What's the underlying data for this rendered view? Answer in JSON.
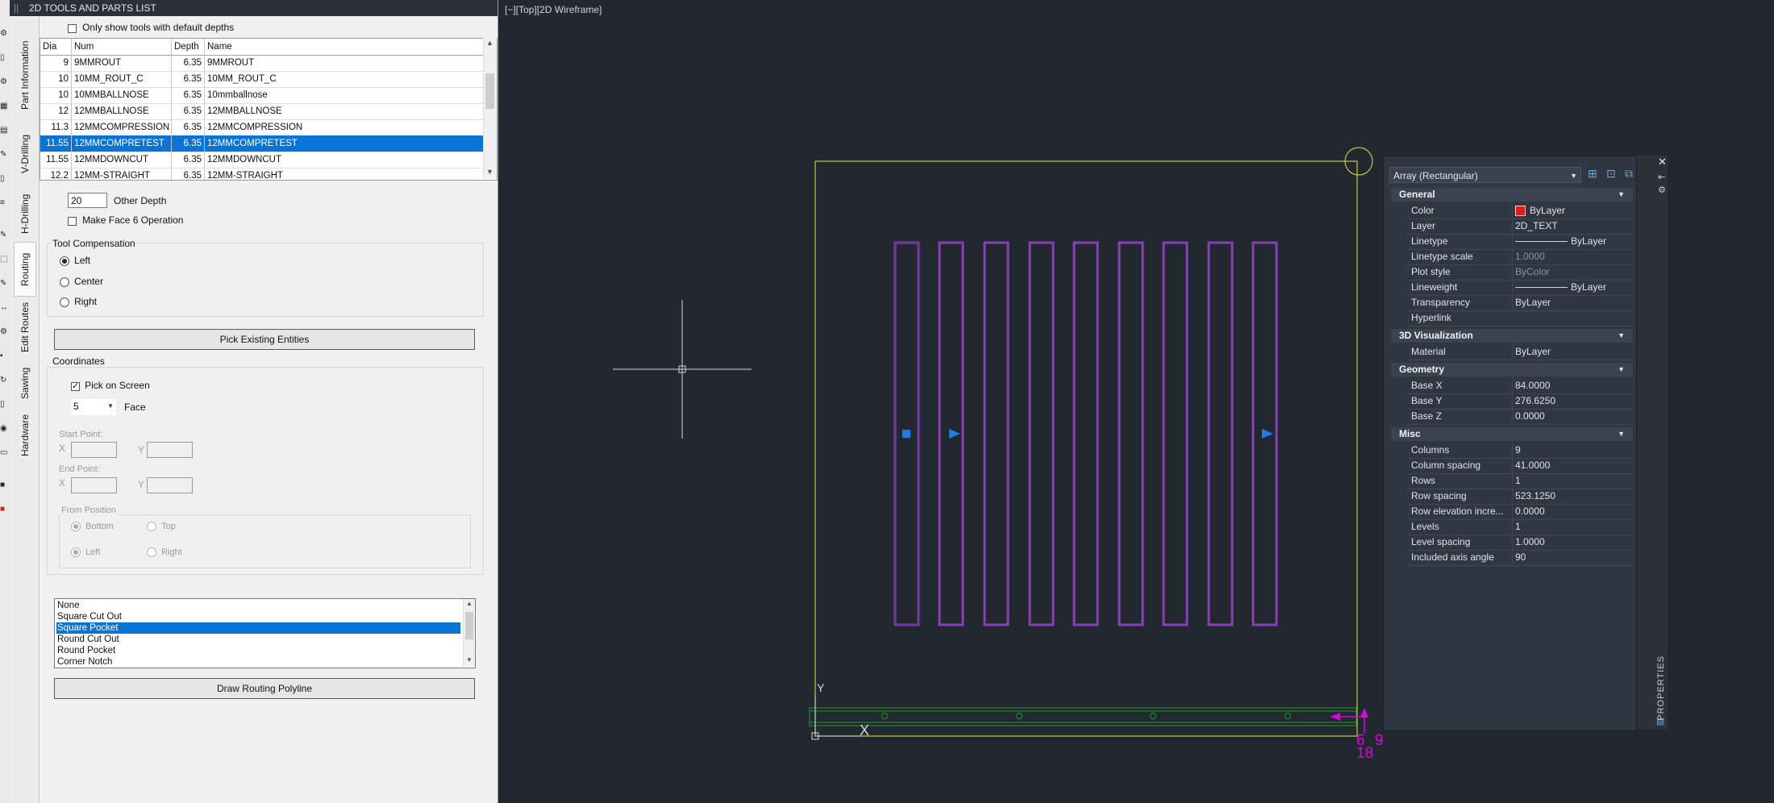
{
  "panel": {
    "title": "2D TOOLS AND PARTS LIST",
    "grip": "||",
    "only_default_depths_label": "Only show tools with default depths",
    "only_default_depths_checked": false,
    "tabs": [
      "Part Information",
      "V-Drilling",
      "H-Drilling",
      "Routing",
      "Edit Routes",
      "Sawing",
      "Hardware"
    ],
    "active_tab": "Routing",
    "table": {
      "headers": [
        "Dia",
        "Num",
        "Depth",
        "Name"
      ],
      "rows": [
        {
          "dia": "9",
          "num": "9MMROUT",
          "depth": "6.35",
          "name": "9MMROUT"
        },
        {
          "dia": "10",
          "num": "10MM_ROUT_C",
          "depth": "6.35",
          "name": "10MM_ROUT_C"
        },
        {
          "dia": "10",
          "num": "10MMBALLNOSE",
          "depth": "6.35",
          "name": "10mmballnose"
        },
        {
          "dia": "12",
          "num": "12MMBALLNOSE",
          "depth": "6.35",
          "name": "12MMBALLNOSE"
        },
        {
          "dia": "11.3",
          "num": "12MMCOMPRESSION",
          "depth": "6.35",
          "name": "12MMCOMPRESSION"
        },
        {
          "dia": "11.55",
          "num": "12MMCOMPRETEST",
          "depth": "6.35",
          "name": "12MMCOMPRETEST",
          "selected": true
        },
        {
          "dia": "11.55",
          "num": "12MMDOWNCUT",
          "depth": "6.35",
          "name": "12MMDOWNCUT"
        },
        {
          "dia": "12.2",
          "num": "12MM-STRAIGHT",
          "depth": "6.35",
          "name": "12MM-STRAIGHT"
        }
      ]
    },
    "other_depth_value": "20",
    "other_depth_label": "Other Depth",
    "face6_label": "Make Face 6 Operation",
    "face6_checked": false,
    "tool_comp": {
      "title": "Tool Compensation",
      "options": [
        "Left",
        "Center",
        "Right"
      ],
      "selected": "Left"
    },
    "pick_existing_label": "Pick Existing Entities",
    "coordinates": {
      "title": "Coordinates",
      "pick_on_screen_label": "Pick on Screen",
      "pick_on_screen_checked": true,
      "face_value": "5",
      "face_label": "Face",
      "start_point_label": "Start Point:",
      "end_point_label": "End Point:",
      "x_label": "X",
      "y_label": "Y",
      "from_position": {
        "title": "From Position",
        "options": [
          "Bottom",
          "Top",
          "Left",
          "Right"
        ],
        "selected": [
          "Bottom",
          "Left"
        ]
      }
    },
    "shape_list": {
      "items": [
        "None",
        "Square Cut Out",
        "Square Pocket",
        "Round Cut Out",
        "Round Pocket",
        "Corner Notch"
      ],
      "selected": "Square Pocket"
    },
    "draw_polyline_label": "Draw Routing Polyline"
  },
  "viewport": {
    "label": "[−][Top][2D Wireframe]",
    "ucs_y": "Y",
    "ucs_x": "X",
    "dim_text_1": "6",
    "dim_text_2": "9",
    "dim_text_3": "18",
    "colors": {
      "border": "#c8c83c",
      "rect": "#8a3fb8",
      "rail": "#1f9a2a",
      "grip": "#1e7ce6",
      "magenta": "#e000e0"
    }
  },
  "properties": {
    "selection": "Array (Rectangular)",
    "side_title": "PROPERTIES",
    "sections": [
      {
        "name": "General",
        "rows": [
          {
            "key": "Color",
            "value": "ByLayer",
            "swatch": "#e21b1b"
          },
          {
            "key": "Layer",
            "value": "2D_TEXT"
          },
          {
            "key": "Linetype",
            "value": "ByLayer",
            "line": true
          },
          {
            "key": "Linetype scale",
            "value": "1.0000",
            "dim": true
          },
          {
            "key": "Plot style",
            "value": "ByColor",
            "dim": true
          },
          {
            "key": "Lineweight",
            "value": "ByLayer",
            "line": true
          },
          {
            "key": "Transparency",
            "value": "ByLayer"
          },
          {
            "key": "Hyperlink",
            "value": ""
          }
        ]
      },
      {
        "name": "3D Visualization",
        "rows": [
          {
            "key": "Material",
            "value": "ByLayer"
          }
        ]
      },
      {
        "name": "Geometry",
        "rows": [
          {
            "key": "Base X",
            "value": "84.0000"
          },
          {
            "key": "Base Y",
            "value": "276.6250"
          },
          {
            "key": "Base Z",
            "value": "0.0000"
          }
        ]
      },
      {
        "name": "Misc",
        "rows": [
          {
            "key": "Columns",
            "value": "9"
          },
          {
            "key": "Column spacing",
            "value": "41.0000"
          },
          {
            "key": "Rows",
            "value": "1"
          },
          {
            "key": "Row spacing",
            "value": "523.1250"
          },
          {
            "key": "Row elevation incre...",
            "value": "0.0000"
          },
          {
            "key": "Levels",
            "value": "1"
          },
          {
            "key": "Level spacing",
            "value": "1.0000"
          },
          {
            "key": "Included axis angle",
            "value": "90"
          }
        ]
      }
    ]
  }
}
